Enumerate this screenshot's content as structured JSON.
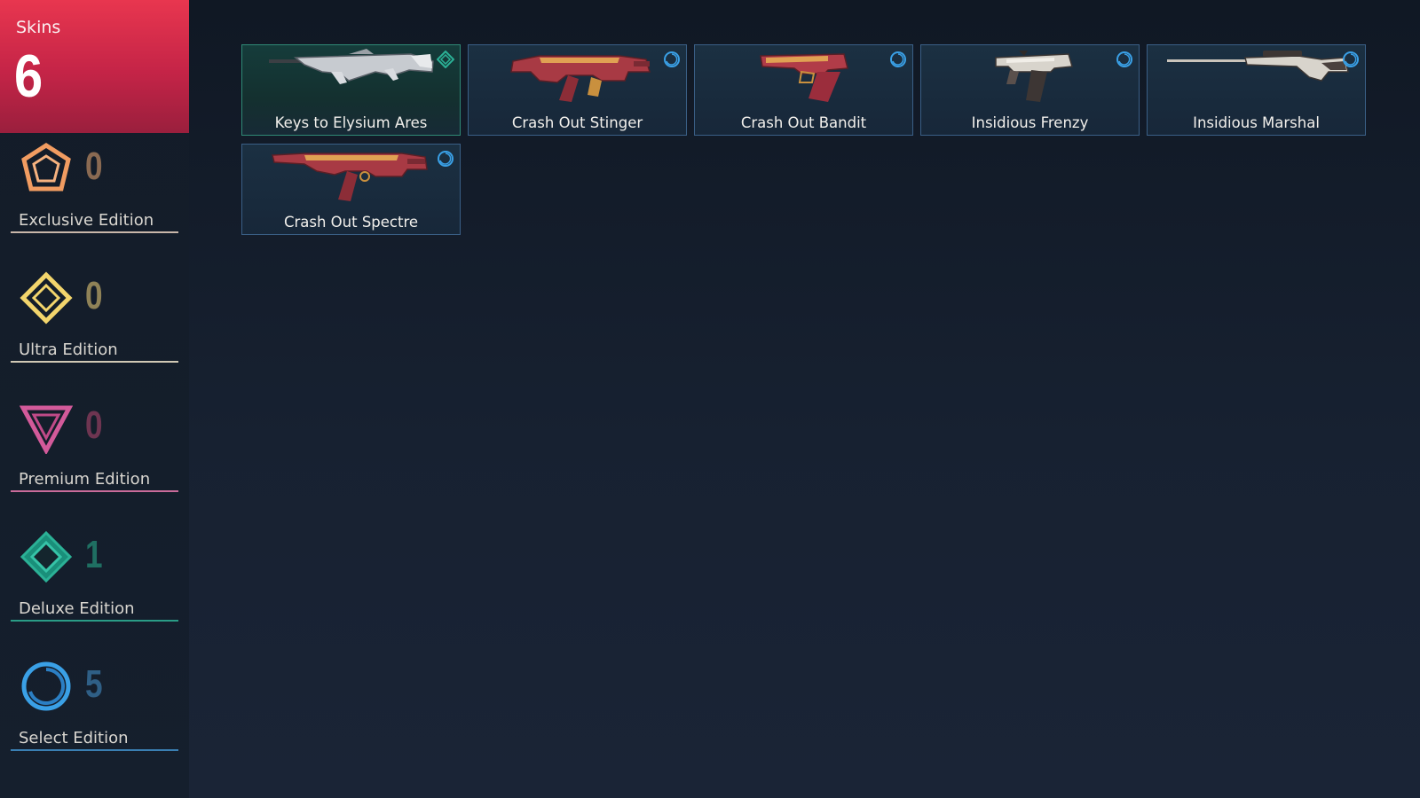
{
  "summary": {
    "label": "Skins",
    "count": "6"
  },
  "editions": [
    {
      "name": "Exclusive Edition",
      "count": "0",
      "icon": "exclusive-edition-icon",
      "color": "#f19c61",
      "count_color": "#8a6a52",
      "line_color": "#c9b7aa"
    },
    {
      "name": "Ultra Edition",
      "count": "0",
      "icon": "ultra-edition-icon",
      "color": "#f3d56c",
      "count_color": "#8f8257",
      "line_color": "#d1c9b5"
    },
    {
      "name": "Premium Edition",
      "count": "0",
      "icon": "premium-edition-icon",
      "color": "#d35a9a",
      "count_color": "#6e3551",
      "line_color": "#c96b9a"
    },
    {
      "name": "Deluxe Edition",
      "count": "1",
      "icon": "deluxe-edition-icon",
      "color": "#2bb196",
      "count_color": "#1f6f62",
      "line_color": "#2a9c86"
    },
    {
      "name": "Select Edition",
      "count": "5",
      "icon": "select-edition-icon",
      "color": "#3aa0e6",
      "count_color": "#2f5f86",
      "line_color": "#3a7fb3"
    }
  ],
  "skins": [
    {
      "name": "Keys to Elysium Ares",
      "tier": "deluxe",
      "tier_icon": "deluxe-tier-icon",
      "weapon_icon": "machine-gun-icon"
    },
    {
      "name": "Crash Out Stinger",
      "tier": "select",
      "tier_icon": "select-tier-icon",
      "weapon_icon": "smg-icon"
    },
    {
      "name": "Crash Out Bandit",
      "tier": "select",
      "tier_icon": "select-tier-icon",
      "weapon_icon": "pistol-icon"
    },
    {
      "name": "Insidious Frenzy",
      "tier": "select",
      "tier_icon": "select-tier-icon",
      "weapon_icon": "machine-pistol-icon"
    },
    {
      "name": "Insidious Marshal",
      "tier": "select",
      "tier_icon": "select-tier-icon",
      "weapon_icon": "sniper-rifle-icon"
    },
    {
      "name": "Crash Out Spectre",
      "tier": "select",
      "tier_icon": "select-tier-icon",
      "weapon_icon": "smg-icon"
    }
  ]
}
